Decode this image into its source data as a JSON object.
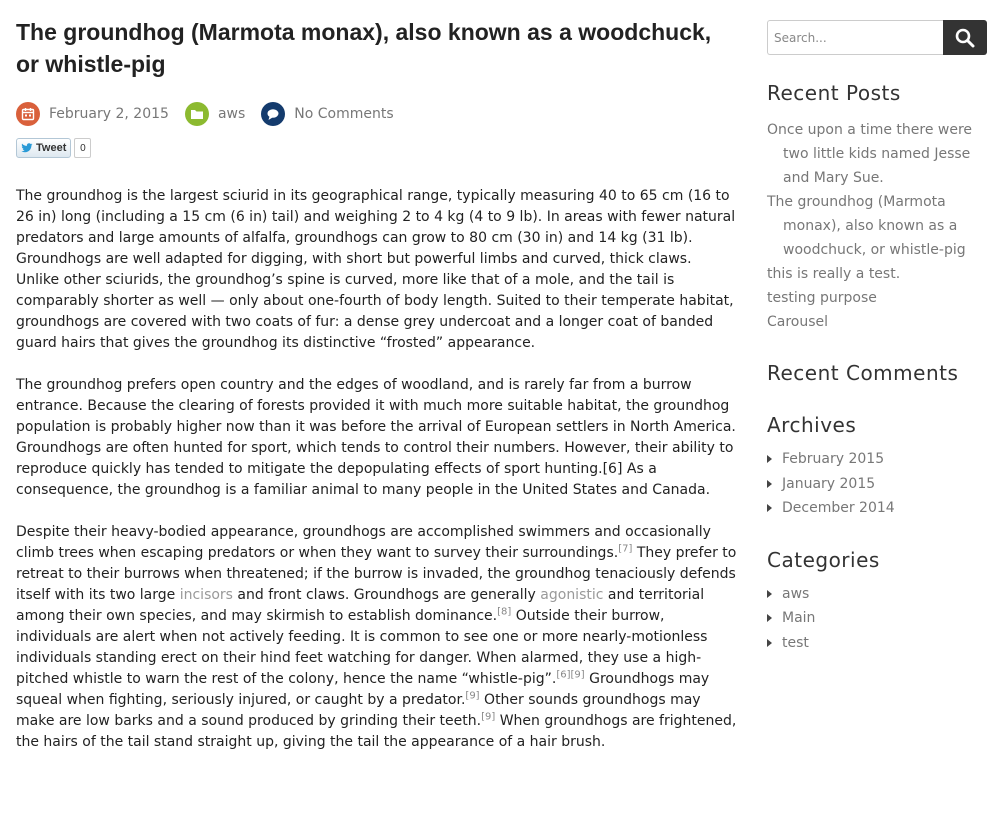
{
  "post": {
    "title": "The groundhog (Marmota monax), also known as a woodchuck, or whistle-pig",
    "date": "February 2, 2015",
    "category": "aws",
    "comments": "No Comments",
    "tweet_label": "Tweet",
    "tweet_count": "0",
    "p1": "The groundhog is the largest sciurid in its geographical range, typically measuring 40 to 65 cm (16 to 26 in) long (including a 15 cm (6 in) tail) and weighing 2 to 4 kg (4 to 9 lb). In areas with fewer natural predators and large amounts of alfalfa, groundhogs can grow to 80 cm (30 in) and 14 kg (31 lb). Groundhogs are well adapted for digging, with short but powerful limbs and curved, thick claws. Unlike other sciurids, the groundhog’s spine is curved, more like that of a mole, and the tail is comparably shorter as well — only about one-fourth of body length. Suited to their temperate habitat, groundhogs are covered with two coats of fur: a dense grey undercoat and a longer coat of banded guard hairs that gives the groundhog its distinctive “frosted” appearance.",
    "p2": "The groundhog prefers open country and the edges of woodland, and is rarely far from a burrow entrance. Because the clearing of forests provided it with much more suitable habitat, the groundhog population is probably higher now than it was before the arrival of European settlers in North America. Groundhogs are often hunted for sport, which tends to control their numbers. However, their ability to reproduce quickly has tended to mitigate the depopulating effects of sport hunting.[6] As a consequence, the groundhog is a familiar animal to many people in the United States and Canada.",
    "p3": {
      "t1": "Despite their heavy-bodied appearance, groundhogs are accomplished swimmers and occasionally climb trees when escaping predators or when they want to survey their surroundings.",
      "ref7": "[7]",
      "t2": " They prefer to retreat to their burrows when threatened; if the burrow is invaded, the groundhog tenaciously defends itself with its two large ",
      "link_incisors": "incisors",
      "t3": " and front claws. Groundhogs are generally ",
      "link_agonistic": "agonistic",
      "t4": " and territorial among their own species, and may skirmish to establish dominance.",
      "ref8": "[8]",
      "t5": " Outside their burrow, individuals are alert when not actively feeding. It is common to see one or more nearly-motionless individuals standing erect on their hind feet watching for danger. When alarmed, they use a high-pitched whistle to warn the rest of the colony, hence the name “whistle-pig”.",
      "ref6": "[6]",
      "ref9a": "[9]",
      "t6": " Groundhogs may squeal when fighting, seriously injured, or caught by a predator.",
      "ref9b": "[9]",
      "t7": " Other sounds groundhogs may make are low barks and a sound produced by grinding their teeth.",
      "ref9c": "[9]",
      "t8": " When groundhogs are frightened, the hairs of the tail stand straight up, giving the tail the appearance of a hair brush."
    }
  },
  "sidebar": {
    "search_placeholder": "Search...",
    "recent_posts_title": "Recent Posts",
    "recent_posts": [
      "Once upon a time there were two little kids named Jesse and Mary Sue.",
      "The groundhog (Marmota monax), also known as a woodchuck, or whistle-pig",
      "this is really a test.",
      "testing purpose",
      "Carousel"
    ],
    "recent_comments_title": "Recent Comments",
    "archives_title": "Archives",
    "archives": [
      "February 2015",
      "January 2015",
      "December 2014"
    ],
    "categories_title": "Categories",
    "categories": [
      "aws",
      "Main",
      "test"
    ]
  },
  "colors": {
    "date_icon": "#d9603b",
    "category_icon": "#8cba30",
    "comments_icon": "#143b6d",
    "search_button": "#333333",
    "link": "#999999"
  },
  "icons": {
    "date": "calendar-icon",
    "category": "folder-icon",
    "comments": "speech-bubble-icon",
    "search": "magnifier-icon",
    "tweet": "twitter-bird-icon",
    "list_bullet": "triangle-right-icon"
  }
}
